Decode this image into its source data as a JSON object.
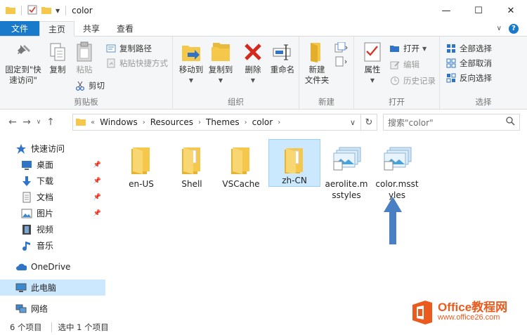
{
  "window": {
    "title": "color"
  },
  "tabs": {
    "file": "文件",
    "home": "主页",
    "share": "共享",
    "view": "查看"
  },
  "ribbon": {
    "clipboard": {
      "label": "剪贴板",
      "pin_line1": "固定到\"快",
      "pin_line2": "速访问\"",
      "copy": "复制",
      "paste": "粘贴",
      "copy_path": "复制路径",
      "paste_shortcut": "粘贴快捷方式",
      "cut": "剪切"
    },
    "organize": {
      "label": "组织",
      "move_to": "移动到",
      "copy_to": "复制到",
      "delete": "删除",
      "rename": "重命名"
    },
    "new": {
      "label": "新建",
      "new_folder_line1": "新建",
      "new_folder_line2": "文件夹"
    },
    "open": {
      "label": "打开",
      "properties": "属性",
      "open": "打开",
      "edit": "编辑",
      "history": "历史记录"
    },
    "select": {
      "label": "选择",
      "select_all": "全部选择",
      "select_none": "全部取消",
      "invert": "反向选择"
    }
  },
  "address": {
    "crumbs": [
      "Windows",
      "Resources",
      "Themes",
      "color"
    ],
    "overflow": "«"
  },
  "search": {
    "placeholder": "搜索\"color\""
  },
  "sidebar": {
    "quick_access": "快速访问",
    "desktop": "桌面",
    "downloads": "下载",
    "documents": "文档",
    "pictures": "图片",
    "videos": "视频",
    "music": "音乐",
    "onedrive": "OneDrive",
    "this_pc": "此电脑",
    "network": "网络"
  },
  "files": [
    {
      "line1": "en-US",
      "line2": ""
    },
    {
      "line1": "Shell",
      "line2": ""
    },
    {
      "line1": "VSCache",
      "line2": ""
    },
    {
      "line1": "zh-CN",
      "line2": ""
    },
    {
      "line1": "aerolite.m",
      "line2": "sstyles"
    },
    {
      "line1": "color.msst",
      "line2": "yles"
    }
  ],
  "status": {
    "count": "6 个项目",
    "selected": "选中 1 个项目"
  },
  "watermark": {
    "line1": "Office教程网",
    "line2": "www.office26.com"
  },
  "colors": {
    "accent": "#1979ca",
    "folder": "#f5c84c",
    "select": "#cce8ff",
    "arrow": "#4a7fc4",
    "brand": "#ea5b1d"
  }
}
